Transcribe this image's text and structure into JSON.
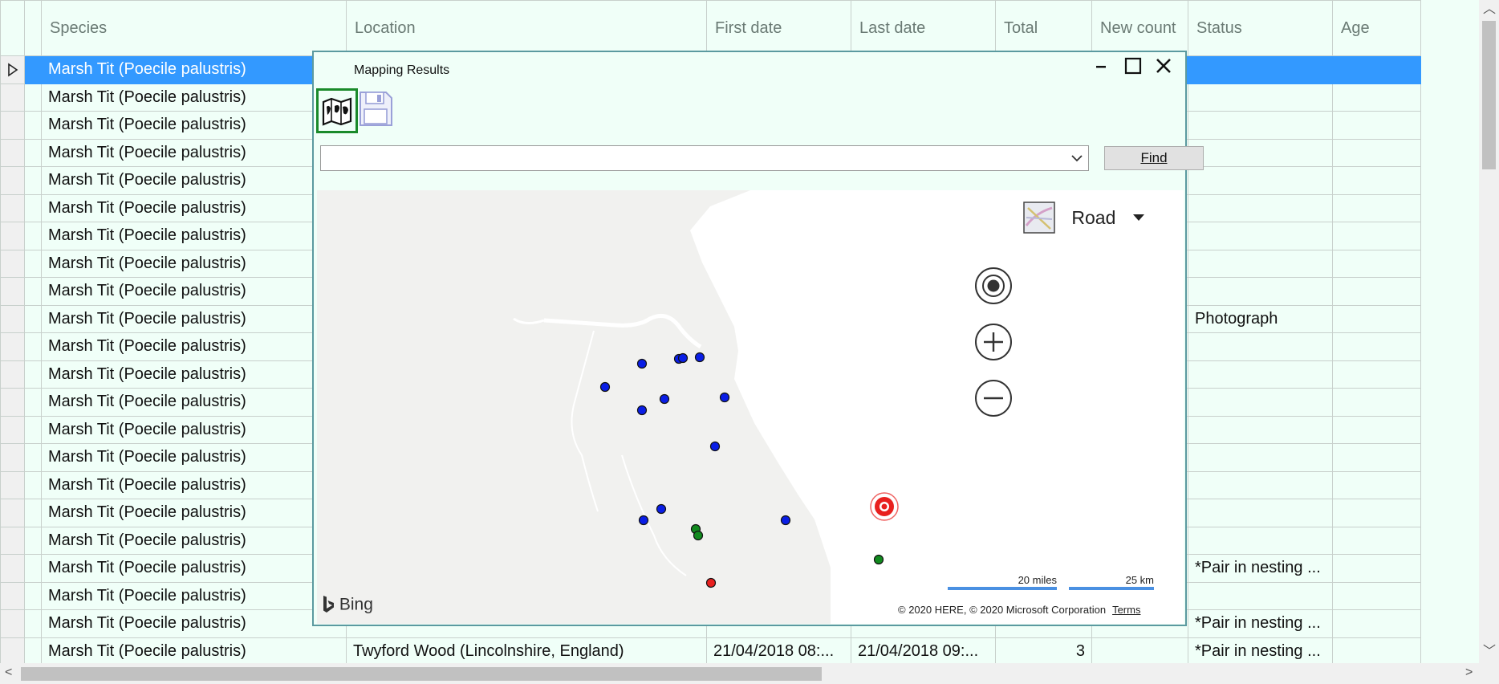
{
  "grid": {
    "columns": [
      "Species",
      "Location",
      "First date",
      "Last date",
      "Total",
      "New count",
      "Status",
      "Age"
    ],
    "rows": [
      {
        "species": "Marsh Tit (Poecile palustris)",
        "location": "",
        "first": "",
        "last": "",
        "total": "",
        "status": "",
        "selected": true
      },
      {
        "species": "Marsh Tit (Poecile palustris)",
        "location": "",
        "first": "",
        "last": "",
        "total": "",
        "status": ""
      },
      {
        "species": "Marsh Tit (Poecile palustris)",
        "location": "",
        "first": "",
        "last": "",
        "total": "",
        "status": ""
      },
      {
        "species": "Marsh Tit (Poecile palustris)",
        "location": "",
        "first": "",
        "last": "",
        "total": "",
        "status": ""
      },
      {
        "species": "Marsh Tit (Poecile palustris)",
        "location": "",
        "first": "",
        "last": "",
        "total": "",
        "status": ""
      },
      {
        "species": "Marsh Tit (Poecile palustris)",
        "location": "",
        "first": "",
        "last": "",
        "total": "",
        "status": ""
      },
      {
        "species": "Marsh Tit (Poecile palustris)",
        "location": "",
        "first": "",
        "last": "",
        "total": "",
        "status": ""
      },
      {
        "species": "Marsh Tit (Poecile palustris)",
        "location": "",
        "first": "",
        "last": "",
        "total": "",
        "status": ""
      },
      {
        "species": "Marsh Tit (Poecile palustris)",
        "location": "",
        "first": "",
        "last": "",
        "total": "",
        "status": ""
      },
      {
        "species": "Marsh Tit (Poecile palustris)",
        "location": "",
        "first": "",
        "last": "",
        "total": "",
        "status": "Photograph"
      },
      {
        "species": "Marsh Tit (Poecile palustris)",
        "location": "",
        "first": "",
        "last": "",
        "total": "",
        "status": ""
      },
      {
        "species": "Marsh Tit (Poecile palustris)",
        "location": "",
        "first": "",
        "last": "",
        "total": "",
        "status": ""
      },
      {
        "species": "Marsh Tit (Poecile palustris)",
        "location": "",
        "first": "",
        "last": "",
        "total": "",
        "status": ""
      },
      {
        "species": "Marsh Tit (Poecile palustris)",
        "location": "",
        "first": "",
        "last": "",
        "total": "",
        "status": ""
      },
      {
        "species": "Marsh Tit (Poecile palustris)",
        "location": "",
        "first": "",
        "last": "",
        "total": "",
        "status": ""
      },
      {
        "species": "Marsh Tit (Poecile palustris)",
        "location": "",
        "first": "",
        "last": "",
        "total": "",
        "status": ""
      },
      {
        "species": "Marsh Tit (Poecile palustris)",
        "location": "",
        "first": "",
        "last": "",
        "total": "",
        "status": ""
      },
      {
        "species": "Marsh Tit (Poecile palustris)",
        "location": "",
        "first": "",
        "last": "",
        "total": "",
        "status": ""
      },
      {
        "species": "Marsh Tit (Poecile palustris)",
        "location": "",
        "first": "",
        "last": "",
        "total": "",
        "status": "*Pair in nesting ..."
      },
      {
        "species": "Marsh Tit (Poecile palustris)",
        "location": "",
        "first": "",
        "last": "",
        "total": "",
        "status": ""
      },
      {
        "species": "Marsh Tit (Poecile palustris)",
        "location": "",
        "first": "",
        "last": "",
        "total": "",
        "status": "*Pair in nesting ..."
      },
      {
        "species": "Marsh Tit (Poecile palustris)",
        "location": "Twyford Wood (Lincolnshire, England)",
        "first": "21/04/2018 08:...",
        "last": "21/04/2018 09:...",
        "total": "3",
        "status": "*Pair in nesting ..."
      }
    ]
  },
  "dialog": {
    "title": "Mapping Results",
    "find_label": "Find",
    "search_value": "",
    "map": {
      "style_label": "Road",
      "brand": "Bing",
      "copyright": "© 2020 HERE, © 2020 Microsoft Corporation",
      "terms": "Terms",
      "scale_miles": "20 miles",
      "scale_km": "25 km"
    }
  },
  "colors": {
    "selected_row": "#3399ff",
    "grid_bg": "#f0fff8",
    "pin_blue": "#0a1ee6",
    "pin_green": "#118a1e",
    "pin_red": "#e8201e",
    "toolbar_active_border": "#1a8a2a"
  }
}
